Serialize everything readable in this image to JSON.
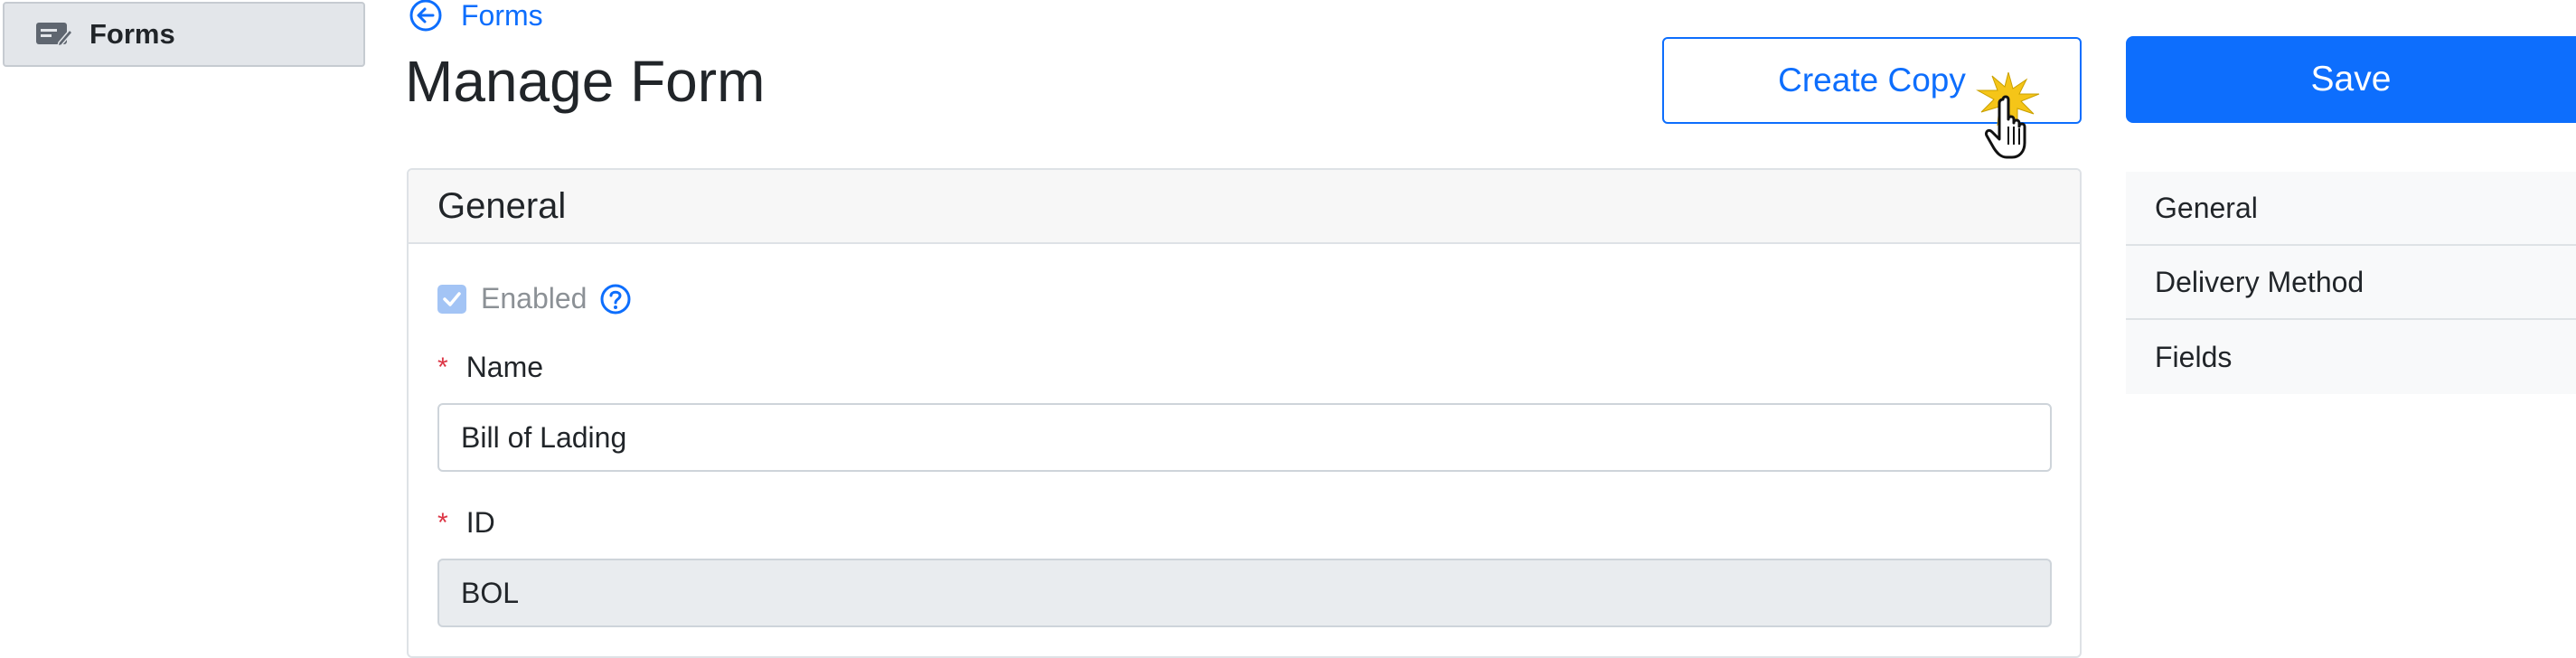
{
  "sidebar": {
    "items": [
      {
        "label": "Forms",
        "icon": "form-edit-icon"
      }
    ]
  },
  "header": {
    "back_label": "Forms",
    "title": "Manage Form",
    "create_copy_label": "Create Copy",
    "save_label": "Save"
  },
  "card": {
    "title": "General",
    "enabled": {
      "label": "Enabled",
      "checked": true
    },
    "name_field": {
      "required_mark": "*",
      "label": "Name",
      "value": "Bill of Lading"
    },
    "id_field": {
      "required_mark": "*",
      "label": "ID",
      "value": "BOL"
    }
  },
  "section_nav": {
    "items": [
      "General",
      "Delivery Method",
      "Fields"
    ]
  },
  "colors": {
    "primary": "#0d6efd",
    "required": "#dc3545",
    "sidebar_active_bg": "#e3e6ea"
  }
}
